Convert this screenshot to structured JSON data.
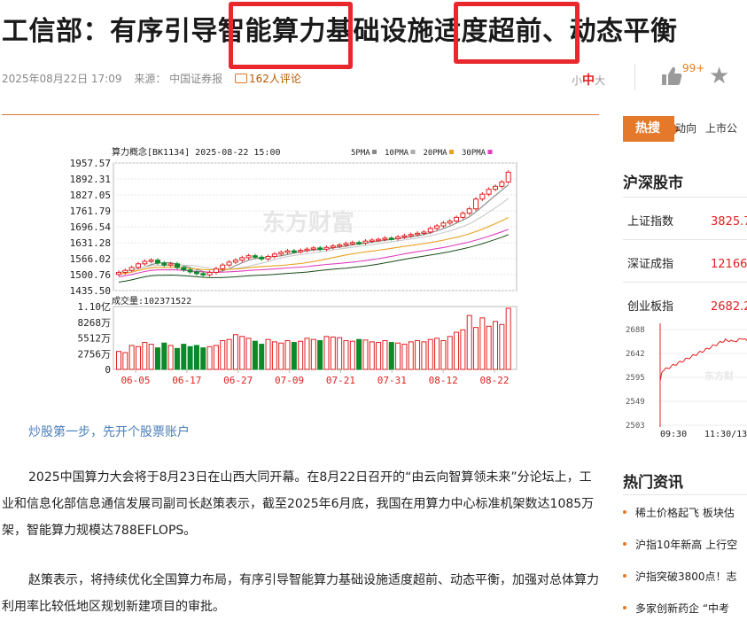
{
  "article": {
    "title": "工信部：有序引导智能算力基础设施适度超前、动态平衡",
    "datetime": "2025年08月22日 17:09",
    "source": "来源：  中国证券报",
    "comments": "162人评论",
    "font_sizes": [
      "小",
      "中",
      "大"
    ],
    "likes": "99+",
    "account_link": "炒股第一步，先开个股票账户",
    "paragraphs": [
      "2025中国算力大会将于8月23日在山西大同开幕。在8月22日召开的“由云向智算领未来”分论坛上，工业和信息化部信息通信发展司副司长赵策表示，截至2025年6月底，我国在用算力中心标准机架数达1085万架，智能算力规模达788EFLOPS。",
      "赵策表示，将持续优化全国算力布局，有序引导智能算力基础设施适度超前、动态平衡，加强对总体算力利用率比较低地区规划新建项目的审批。"
    ]
  },
  "sidebar": {
    "hot_label": "热搜",
    "hot_links": [
      "动向",
      "上市公"
    ],
    "market_title": "沪深股市",
    "indices": [
      {
        "name": "上证指数",
        "value": "3825.7"
      },
      {
        "name": "深证成指",
        "value": "12166.0"
      },
      {
        "name": "创业板指",
        "value": "2682.2"
      }
    ],
    "mini_chart": {
      "y_ticks": [
        "2688",
        "2642",
        "2595",
        "2549",
        "2503"
      ],
      "x_ticks": [
        "09:30",
        "11:30/13"
      ],
      "watermark": "东方财"
    },
    "news_title": "热门资讯",
    "news": [
      "稀土价格起飞 板块估",
      "沪指10年新高 上行空",
      "沪指突破3800点！志",
      "多家创新药企 “中考"
    ]
  },
  "colors": {
    "up": "#e02020",
    "down": "#0a8a28",
    "accent": "#e4792b",
    "highlight_box": "#e8282d"
  },
  "chart_data": {
    "type": "candlestick",
    "header": "算力概念[BK1134] 2025-08-22 15:00",
    "legend": [
      {
        "name": "5PMA",
        "color": "#888888"
      },
      {
        "name": "10PMA",
        "color": "#aaaaaa"
      },
      {
        "name": "20PMA",
        "color": "#e8a020"
      },
      {
        "name": "30PMA",
        "color": "#e040c0"
      }
    ],
    "price_ticks": [
      "1957.57",
      "1892.31",
      "1827.05",
      "1761.79",
      "1696.54",
      "1631.28",
      "1566.02",
      "1500.76",
      "1435.50"
    ],
    "ylim": [
      1435.5,
      1957.57
    ],
    "volume_label": "成交量:102371522",
    "volume_ticks": [
      "1.10亿",
      "8268万",
      "5512万",
      "2756万",
      "0"
    ],
    "volume_max": 110000000,
    "x_ticks": [
      "06-05",
      "06-17",
      "06-27",
      "07-09",
      "07-21",
      "07-31",
      "08-12",
      "08-22"
    ],
    "watermark": "东方财富",
    "closes": [
      1510,
      1518,
      1530,
      1545,
      1555,
      1560,
      1548,
      1540,
      1545,
      1530,
      1520,
      1512,
      1505,
      1500,
      1510,
      1525,
      1540,
      1552,
      1560,
      1570,
      1578,
      1572,
      1565,
      1575,
      1585,
      1592,
      1598,
      1595,
      1600,
      1605,
      1610,
      1605,
      1612,
      1618,
      1622,
      1628,
      1632,
      1630,
      1638,
      1642,
      1645,
      1650,
      1648,
      1655,
      1660,
      1665,
      1670,
      1675,
      1690,
      1700,
      1712,
      1720,
      1735,
      1752,
      1770,
      1810,
      1830,
      1850,
      1862,
      1880,
      1920
    ],
    "volumes": [
      30,
      28,
      40,
      38,
      45,
      42,
      36,
      44,
      40,
      35,
      42,
      38,
      40,
      36,
      38,
      40,
      48,
      50,
      58,
      55,
      52,
      47,
      42,
      50,
      46,
      44,
      48,
      45,
      47,
      52,
      50,
      48,
      55,
      54,
      53,
      48,
      47,
      50,
      49,
      46,
      45,
      48,
      45,
      44,
      42,
      46,
      48,
      46,
      50,
      52,
      48,
      55,
      62,
      66,
      90,
      70,
      86,
      72,
      80,
      75,
      102
    ]
  }
}
